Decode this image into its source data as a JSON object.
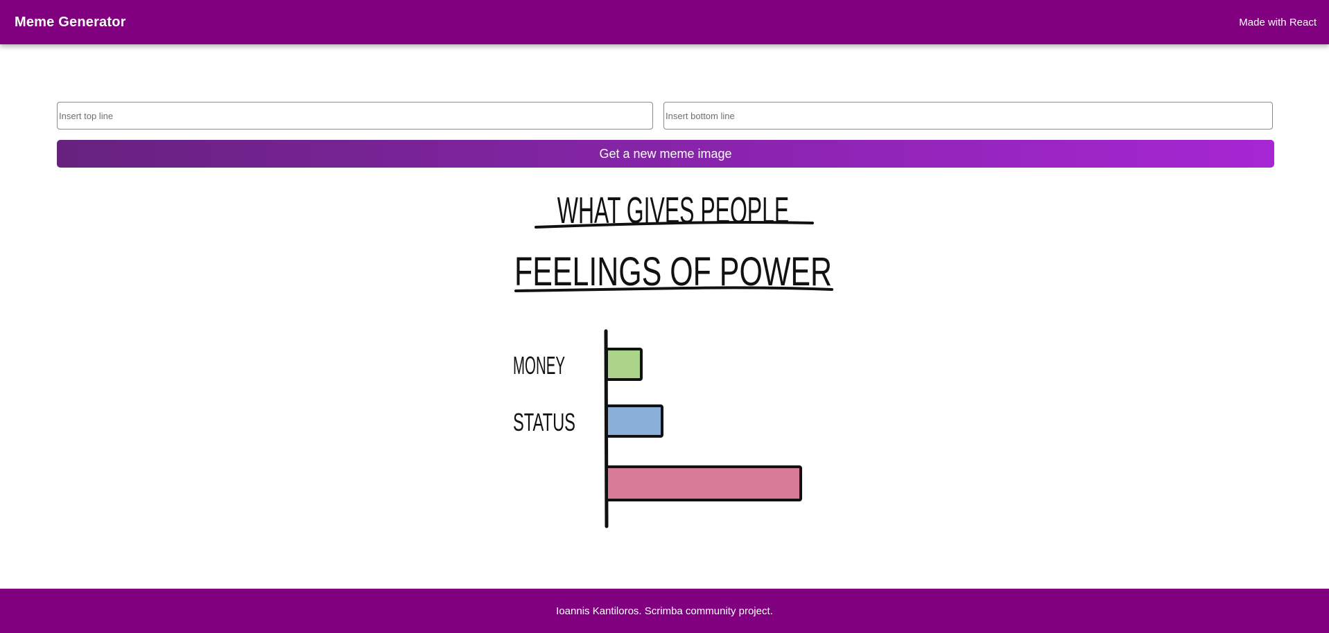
{
  "header": {
    "title": "Meme Generator",
    "tagline": "Made with React"
  },
  "form": {
    "top_placeholder": "Insert top line",
    "top_value": "",
    "bottom_placeholder": "Insert bottom line",
    "bottom_value": "",
    "button_label": "Get a new meme image"
  },
  "meme": {
    "title_line1": "WHAT GIVES PEOPLE",
    "title_line2": "FEELINGS OF POWER",
    "bars": [
      {
        "label": "MONEY",
        "value": 1,
        "color": "#acd38a"
      },
      {
        "label": "STATUS",
        "value": 1.6,
        "color": "#8aafd8"
      },
      {
        "label": "",
        "value": 5.6,
        "color": "#d87b96"
      }
    ]
  },
  "footer": {
    "text": "Ioannis Kantiloros. Scrimba community project."
  },
  "colors": {
    "brand": "#800080",
    "button_gradient_start": "#672280",
    "button_gradient_end": "#A626D3"
  }
}
